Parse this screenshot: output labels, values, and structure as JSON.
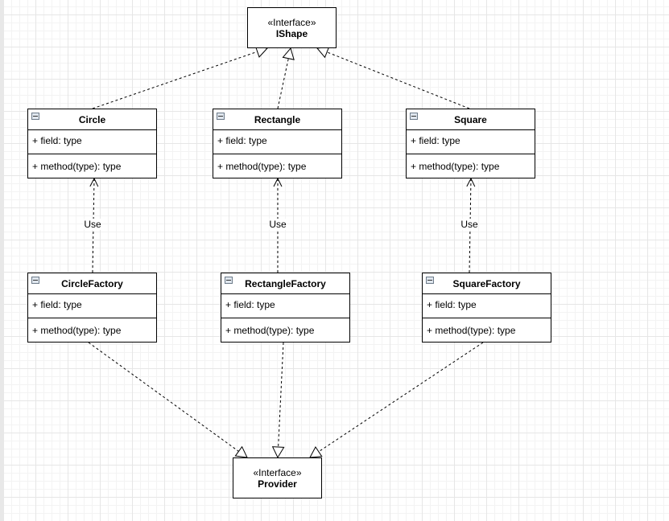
{
  "interfaces": {
    "ishape": {
      "stereotype": "«Interface»",
      "name": "IShape"
    },
    "provider": {
      "stereotype": "«Interface»",
      "name": "Provider"
    }
  },
  "classes": [
    {
      "name": "Circle",
      "field": "+ field: type",
      "method": "+ method(type): type"
    },
    {
      "name": "Rectangle",
      "field": "+ field: type",
      "method": "+ method(type): type"
    },
    {
      "name": "Square",
      "field": "+ field: type",
      "method": "+ method(type): type"
    },
    {
      "name": "CircleFactory",
      "field": "+ field: type",
      "method": "+ method(type): type"
    },
    {
      "name": "RectangleFactory",
      "field": "+ field: type",
      "method": "+ method(type): type"
    },
    {
      "name": "SquareFactory",
      "field": "+ field: type",
      "method": "+ method(type): type"
    }
  ],
  "edges": {
    "use_label": "Use"
  }
}
